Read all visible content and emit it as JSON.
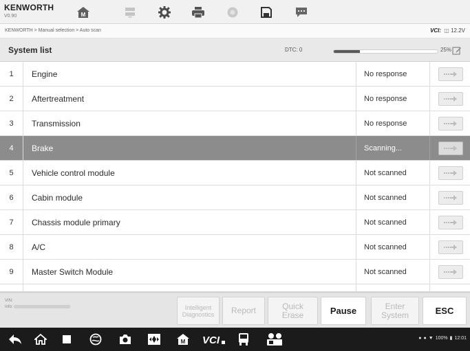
{
  "vehicle": {
    "make": "KENWORTH",
    "version": "V0.90"
  },
  "breadcrumb": "KENWORTH > Manual selection > Auto scan",
  "vci": {
    "label": "VCI:",
    "voltage": "12.2V"
  },
  "list": {
    "title": "System list",
    "dtc_label": "DTC: 0",
    "progress_percent": 25,
    "progress_label": "25%"
  },
  "rows": [
    {
      "num": "1",
      "name": "Engine",
      "status": "No response"
    },
    {
      "num": "2",
      "name": "Aftertreatment",
      "status": "No response"
    },
    {
      "num": "3",
      "name": "Transmission",
      "status": "No response"
    },
    {
      "num": "4",
      "name": "Brake",
      "status": "Scanning...",
      "active": true
    },
    {
      "num": "5",
      "name": "Vehicle control module",
      "status": "Not scanned"
    },
    {
      "num": "6",
      "name": "Cabin module",
      "status": "Not scanned"
    },
    {
      "num": "7",
      "name": "Chassis module primary",
      "status": "Not scanned"
    },
    {
      "num": "8",
      "name": "A/C",
      "status": "Not scanned"
    },
    {
      "num": "9",
      "name": "Master Switch Module",
      "status": "Not scanned"
    }
  ],
  "vin_info": {
    "vin_label": "VIN:",
    "info_label": "Info:"
  },
  "buttons": {
    "intelligent": "Intelligent\nDiagnostics",
    "report": "Report",
    "quick_erase": "Quick\nErase",
    "pause": "Pause",
    "enter_system": "Enter\nSystem",
    "esc": "ESC"
  },
  "status_bar": {
    "battery": "100%",
    "time": "12:01"
  },
  "icons": {
    "toolbar": [
      "home-icon",
      "vehicle-swap-icon",
      "settings-icon",
      "print-icon",
      "help-icon",
      "save-icon",
      "message-icon"
    ],
    "nav": [
      "back-icon",
      "home-icon",
      "recents-icon",
      "browser-icon",
      "camera-icon",
      "screen-capture-icon",
      "autel-home-icon",
      "vci-icon",
      "vehicle-icon",
      "remote-desk-icon"
    ]
  }
}
